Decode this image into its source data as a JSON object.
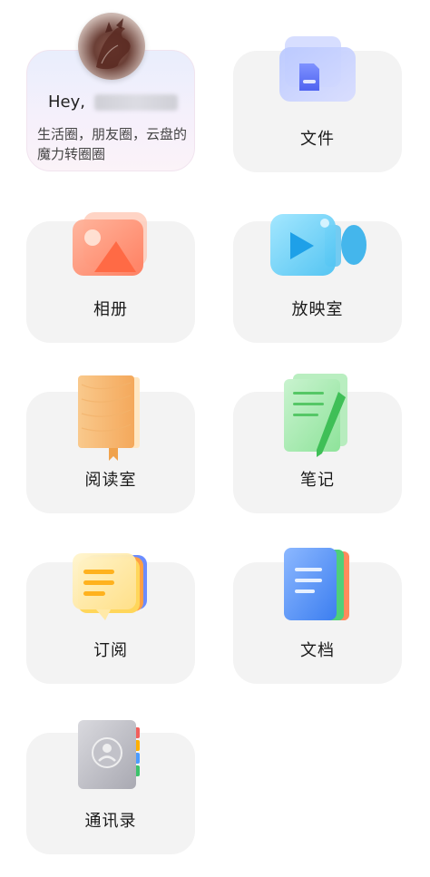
{
  "profile": {
    "greeting": "Hey,",
    "description": "生活圈，朋友圈，云盘的魔力转圈圈"
  },
  "tiles": [
    {
      "label": "文件",
      "icon": "folder-icon"
    },
    {
      "label": "相册",
      "icon": "photo-album-icon"
    },
    {
      "label": "放映室",
      "icon": "video-camera-icon"
    },
    {
      "label": "阅读室",
      "icon": "book-icon"
    },
    {
      "label": "笔记",
      "icon": "notes-pen-icon"
    },
    {
      "label": "订阅",
      "icon": "subscription-message-icon"
    },
    {
      "label": "文档",
      "icon": "document-icon"
    },
    {
      "label": "通讯录",
      "icon": "contacts-icon"
    }
  ],
  "colors": {
    "tile_bg": "#f3f3f3",
    "text": "#1a1a1a"
  }
}
